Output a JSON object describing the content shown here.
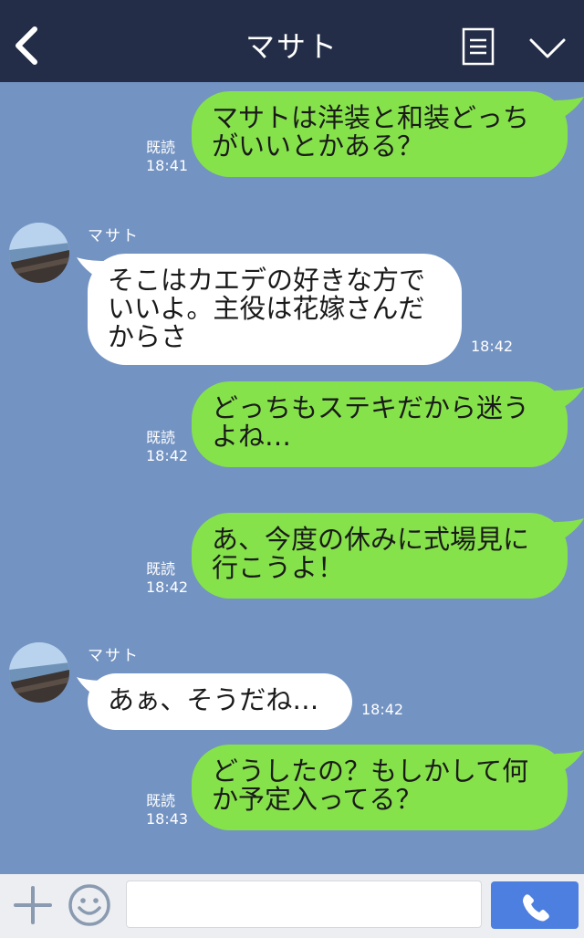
{
  "header": {
    "title": "マサト",
    "back_icon": "chevron-left-icon",
    "menu_icon": "list-menu-icon",
    "collapse_icon": "chevron-down-icon"
  },
  "colors": {
    "header_bg": "#232d47",
    "chat_bg": "#7393c2",
    "sent_bubble": "#86e24a",
    "received_bubble": "#ffffff",
    "send_button": "#4c7fe0"
  },
  "messages": [
    {
      "direction": "sent",
      "lines": [
        "マサトは洋装と和装どっち",
        "がいいとかある？"
      ],
      "read": "既読",
      "time": "18:41"
    },
    {
      "direction": "received",
      "sender": "マサト",
      "lines": [
        "そこはカエデの好きな方で",
        "いいよ。主役は花嫁さんだ",
        "からさ"
      ],
      "time": "18:42"
    },
    {
      "direction": "sent",
      "lines": [
        "どっちもステキだから迷う",
        "よね…"
      ],
      "read": "既読",
      "time": "18:42"
    },
    {
      "direction": "sent",
      "lines": [
        "あ、今度の休みに式場見に",
        "行こうよ！"
      ],
      "read": "既読",
      "time": "18:42"
    },
    {
      "direction": "received",
      "sender": "マサト",
      "lines": [
        "あぁ、そうだね…"
      ],
      "time": "18:42"
    },
    {
      "direction": "sent",
      "lines": [
        "どうしたの？もしかして何",
        "か予定入ってる？"
      ],
      "read": "既読",
      "time": "18:43"
    }
  ],
  "input_bar": {
    "plus_icon": "plus-icon",
    "emoji_icon": "smiley-icon",
    "placeholder": "",
    "call_icon": "phone-icon"
  }
}
